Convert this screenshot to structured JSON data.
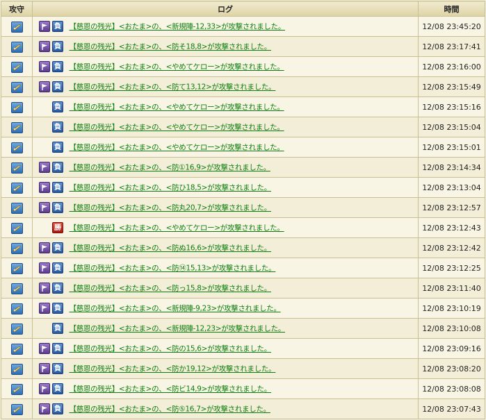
{
  "header": {
    "col_attack": "攻守",
    "col_log": "ログ",
    "col_time": "時間"
  },
  "icons": {
    "attack_button": "sword-icon",
    "flag": "flag-icon",
    "lose_badge_color": "#3c6fb5",
    "win_badge_color": "#c8281c"
  },
  "rows": [
    {
      "flag": true,
      "result": "負",
      "result_type": "lose",
      "message": "【慈恩の残光】<おたま>の、<新規陣-12,33>が攻撃されました。",
      "time": "12/08 23:45:20"
    },
    {
      "flag": true,
      "result": "負",
      "result_type": "lose",
      "message": "【慈恩の残光】<おたま>の、<防そ18,8>が攻撃されました。",
      "time": "12/08 23:17:41"
    },
    {
      "flag": true,
      "result": "負",
      "result_type": "lose",
      "message": "【慈恩の残光】<おたま>の、<やめてケロー>が攻撃されました。",
      "time": "12/08 23:16:00"
    },
    {
      "flag": true,
      "result": "負",
      "result_type": "lose",
      "message": "【慈恩の残光】<おたま>の、<防て13,12>が攻撃されました。",
      "time": "12/08 23:15:49"
    },
    {
      "flag": false,
      "result": "負",
      "result_type": "lose",
      "message": "【慈恩の残光】<おたま>の、<やめてケロー>が攻撃されました。",
      "time": "12/08 23:15:16"
    },
    {
      "flag": false,
      "result": "負",
      "result_type": "lose",
      "message": "【慈恩の残光】<おたま>の、<やめてケロー>が攻撃されました。",
      "time": "12/08 23:15:04"
    },
    {
      "flag": false,
      "result": "負",
      "result_type": "lose",
      "message": "【慈恩の残光】<おたま>の、<やめてケロー>が攻撃されました。",
      "time": "12/08 23:15:01"
    },
    {
      "flag": true,
      "result": "負",
      "result_type": "lose",
      "message": "【慈恩の残光】<おたま>の、<防①16,9>が攻撃されました。",
      "time": "12/08 23:14:34"
    },
    {
      "flag": true,
      "result": "負",
      "result_type": "lose",
      "message": "【慈恩の残光】<おたま>の、<防ひ18,5>が攻撃されました。",
      "time": "12/08 23:13:04"
    },
    {
      "flag": true,
      "result": "負",
      "result_type": "lose",
      "message": "【慈恩の残光】<おたま>の、<防丸20,7>が攻撃されました。",
      "time": "12/08 23:12:57"
    },
    {
      "flag": false,
      "result": "勝",
      "result_type": "win",
      "message": "【慈恩の残光】<おたま>の、<やめてケロー>が攻撃されました。",
      "time": "12/08 23:12:43"
    },
    {
      "flag": true,
      "result": "負",
      "result_type": "lose",
      "message": "【慈恩の残光】<おたま>の、<防ぬ16,6>が攻撃されました。",
      "time": "12/08 23:12:42"
    },
    {
      "flag": true,
      "result": "負",
      "result_type": "lose",
      "message": "【慈恩の残光】<おたま>の、<防⑭15,13>が攻撃されました。",
      "time": "12/08 23:12:25"
    },
    {
      "flag": true,
      "result": "負",
      "result_type": "lose",
      "message": "【慈恩の残光】<おたま>の、<防っ15,8>が攻撃されました。",
      "time": "12/08 23:11:40"
    },
    {
      "flag": true,
      "result": "負",
      "result_type": "lose",
      "message": "【慈恩の残光】<おたま>の、<新規陣-9,23>が攻撃されました。",
      "time": "12/08 23:10:19"
    },
    {
      "flag": false,
      "result": "負",
      "result_type": "lose",
      "message": "【慈恩の残光】<おたま>の、<新規陣-12,23>が攻撃されました。",
      "time": "12/08 23:10:08"
    },
    {
      "flag": true,
      "result": "負",
      "result_type": "lose",
      "message": "【慈恩の残光】<おたま>の、<防の15,6>が攻撃されました。",
      "time": "12/08 23:09:16"
    },
    {
      "flag": true,
      "result": "負",
      "result_type": "lose",
      "message": "【慈恩の残光】<おたま>の、<防か19,12>が攻撃されました。",
      "time": "12/08 23:08:20"
    },
    {
      "flag": true,
      "result": "負",
      "result_type": "lose",
      "message": "【慈恩の残光】<おたま>の、<防ビ14,9>が攻撃されました。",
      "time": "12/08 23:08:08"
    },
    {
      "flag": true,
      "result": "負",
      "result_type": "lose",
      "message": "【慈恩の残光】<おたま>の、<防⑤16,7>が攻撃されました。",
      "time": "12/08 23:07:43"
    }
  ]
}
